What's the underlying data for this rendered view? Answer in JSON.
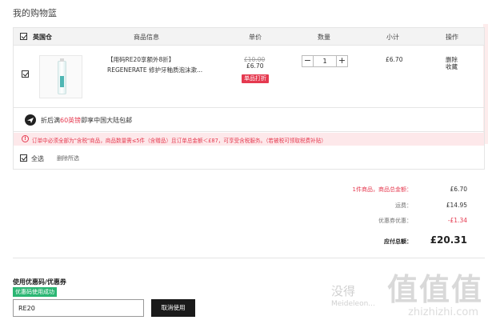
{
  "page": {
    "title": "我的购物篮"
  },
  "cart": {
    "headers": {
      "warehouse": "英国仓",
      "product_info": "商品信息",
      "unit_price": "单价",
      "quantity": "数量",
      "subtotal": "小计",
      "actions": "操作"
    },
    "item": {
      "name_line1": "【用码RE20享额外8折】",
      "name_line2": "REGENERATE 修护牙釉质泡沫漱...",
      "original_price": "£10.00",
      "price": "£6.70",
      "promo_badge": "单品打折",
      "quantity": "1",
      "subtotal": "£6.70",
      "delete_label": "删除",
      "favorite_label": "收藏",
      "checked": true
    },
    "shipping": {
      "text_before": "折后满",
      "highlight": "60英镑",
      "text_after": "即享中国大陆包邮",
      "icon": "airplane-icon"
    },
    "notice": {
      "text": "订单中必须全部为\"含税\"商品，商品数量需≤5件（含赠品）且订单总金额＜£87，可享受含税服务。（若被税可领取税费补贴）"
    },
    "footer": {
      "select_all": "全选",
      "delete_selected": "删除所选"
    }
  },
  "summary": {
    "items_count_label": "1件商品，商品总金额：",
    "items_total": "£6.70",
    "shipping_label": "运费：",
    "shipping_value": "£14.95",
    "discount_label": "优惠券优惠：",
    "discount_value": "-£1.34",
    "total_label": "应付总额：",
    "total_value": "£20.31"
  },
  "coupon": {
    "label": "使用优惠码/优惠券",
    "status": "优惠码使用成功",
    "code": "RE20",
    "cancel_label": "取消使用"
  },
  "watermark": {
    "big": "值值值",
    "sub": "没得",
    "url": "Meideleon...",
    "url2": "zhizhizhi.com"
  },
  "colors": {
    "accent": "#e5394f",
    "success": "#2bb673",
    "dark_button": "#1a1a1a"
  }
}
